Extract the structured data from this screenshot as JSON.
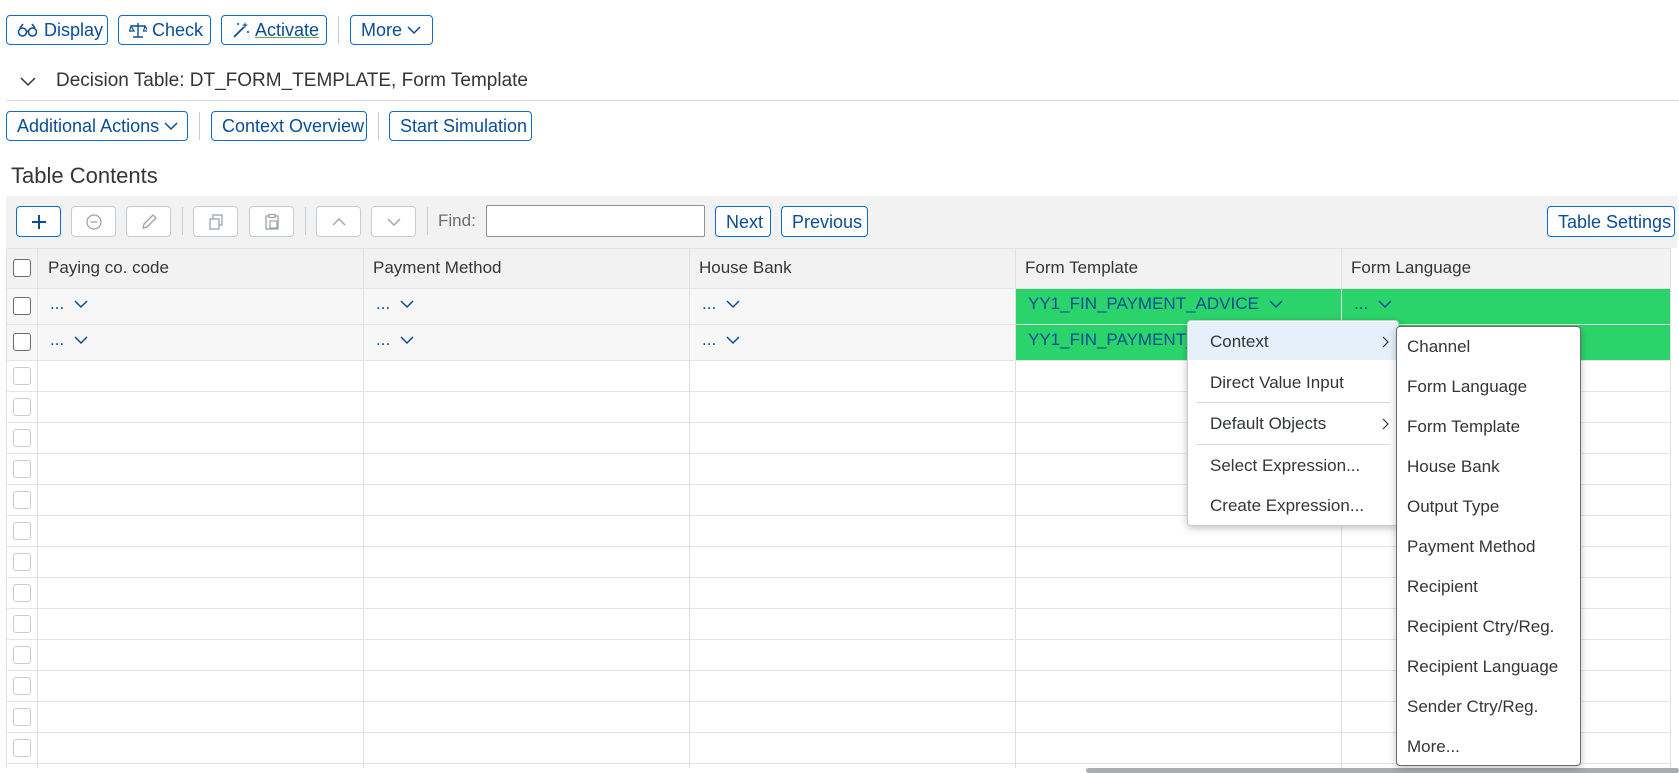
{
  "top_toolbar": {
    "display_label": "Display",
    "check_label": "Check",
    "activate_label": "Activate",
    "more_label": "More"
  },
  "header": {
    "title": "Decision Table: DT_FORM_TEMPLATE, Form Template"
  },
  "actions": {
    "additional_actions_label": "Additional Actions",
    "context_overview_label": "Context Overview",
    "start_simulation_label": "Start Simulation"
  },
  "section": {
    "title": "Table Contents"
  },
  "table_toolbar": {
    "find_label": "Find:",
    "find_value": "",
    "next_label": "Next",
    "previous_label": "Previous",
    "table_settings_label": "Table Settings"
  },
  "table": {
    "columns": [
      "Paying co. code",
      "Payment Method",
      "House Bank",
      "Form Template",
      "Form Language"
    ],
    "rows": [
      [
        "...",
        "...",
        "...",
        "YY1_FIN_PAYMENT_ADVICE",
        "..."
      ],
      [
        "...",
        "...",
        "...",
        "YY1_FIN_PAYMENT_",
        "..."
      ]
    ],
    "highlight_color": "#2bd46a"
  },
  "context_menu": {
    "items": [
      "Context",
      "Direct Value Input",
      "Default Objects",
      "Select Expression...",
      "Create Expression..."
    ]
  },
  "submenu": {
    "items": [
      "Channel",
      "Form Language",
      "Form Template",
      "House Bank",
      "Output Type",
      "Payment Method",
      "Recipient",
      "Recipient Ctry/Reg.",
      "Recipient Language",
      "Sender Ctry/Reg.",
      "More..."
    ]
  },
  "colors": {
    "accent": "#0a6ed1",
    "hover": "#e5f0fa"
  }
}
